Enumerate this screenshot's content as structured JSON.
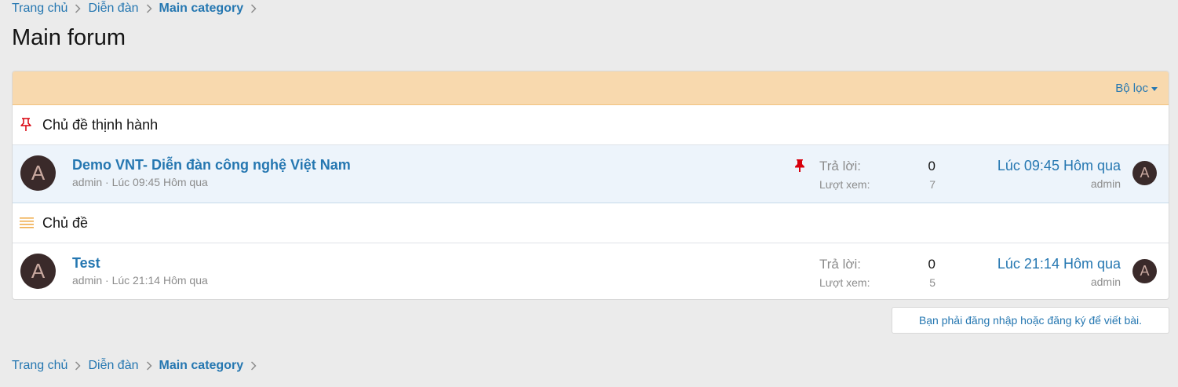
{
  "breadcrumb": {
    "items": [
      {
        "label": "Trang chủ"
      },
      {
        "label": "Diễn đàn"
      },
      {
        "label": "Main category"
      }
    ]
  },
  "page": {
    "title": "Main forum"
  },
  "filter": {
    "label": "Bộ lọc"
  },
  "sections": {
    "sticky_heading": "Chủ đề thịnh hành",
    "normal_heading": "Chủ đề"
  },
  "threads": [
    {
      "title": "Demo VNT- Diễn đàn công nghệ Việt Nam",
      "author": "admin",
      "sep": " · ",
      "time": "Lúc 09:45 Hôm qua",
      "avatar_letter": "A",
      "replies_label": "Trả lời:",
      "replies": "0",
      "views_label": "Lượt xem:",
      "views": "7",
      "last_time": "Lúc 09:45 Hôm qua",
      "last_user": "admin",
      "last_avatar_letter": "A"
    },
    {
      "title": "Test",
      "author": "admin",
      "sep": " · ",
      "time": "Lúc 21:14 Hôm qua",
      "avatar_letter": "A",
      "replies_label": "Trả lời:",
      "replies": "0",
      "views_label": "Lượt xem:",
      "views": "5",
      "last_time": "Lúc 21:14 Hôm qua",
      "last_user": "admin",
      "last_avatar_letter": "A"
    }
  ],
  "notice": {
    "text": "Bạn phải đăng nhập hoặc đăng ký để viết bài."
  },
  "colors": {
    "link": "#2577b1",
    "filter_bar": "#f8d9ae",
    "sticky_bg": "#edf4fb",
    "pin": "#d8000c",
    "list_icon": "#f0ad4e"
  }
}
